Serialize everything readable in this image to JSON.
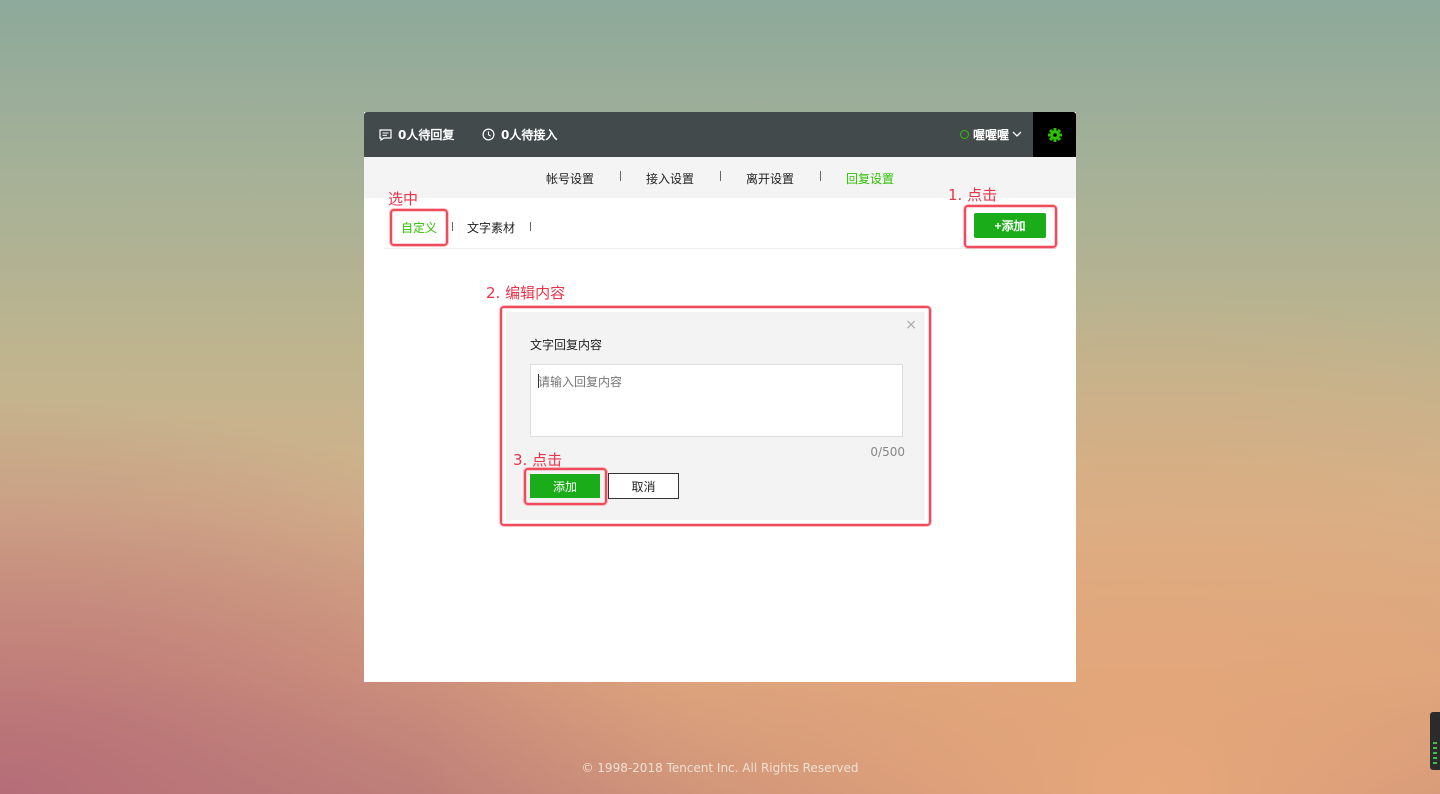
{
  "topbar": {
    "pending_reply": "0人待回复",
    "pending_access": "0人待接入",
    "username": "喔喔喔"
  },
  "nav": {
    "tabs": [
      {
        "label": "帐号设置",
        "active": false
      },
      {
        "label": "接入设置",
        "active": false
      },
      {
        "label": "离开设置",
        "active": false
      },
      {
        "label": "回复设置",
        "active": true
      }
    ]
  },
  "subnav": {
    "tabs": [
      {
        "label": "自定义",
        "active": true
      },
      {
        "label": "文字素材",
        "active": false
      }
    ],
    "add_button": "+添加"
  },
  "dialog": {
    "close": "×",
    "title": "文字回复内容",
    "placeholder": "请输入回复内容",
    "counter": "0/500",
    "ok": "添加",
    "cancel": "取消"
  },
  "annotations": {
    "select": "选中",
    "step1": "1. 点击",
    "step2": "2. 编辑内容",
    "step3": "3. 点击"
  },
  "footer": "© 1998-2018 Tencent Inc. All Rights Reserved",
  "colors": {
    "accent_green": "#1aad19",
    "active_tab_green": "#2dc100",
    "topbar_bg": "#434a4b",
    "annotation_red": "#e8344b"
  }
}
